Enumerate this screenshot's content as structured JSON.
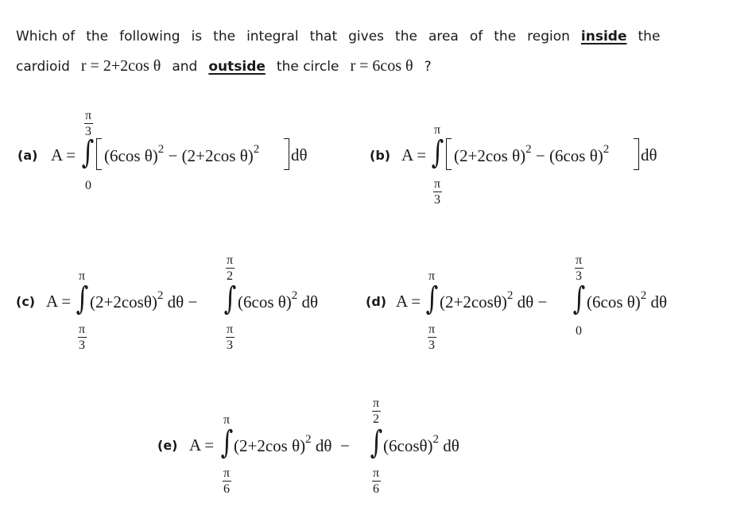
{
  "question": {
    "line1": {
      "words": [
        "Which of",
        "the",
        "following",
        "is",
        "the",
        "integral",
        "that",
        "gives",
        "the",
        "area",
        "of",
        "the",
        "region"
      ],
      "emph1": "inside",
      "tail": "the"
    },
    "line2": {
      "pre": "cardioid",
      "cardioid_eq": "r = 2+2cos θ",
      "and": "and",
      "emph2": "outside",
      "mid": "the circle",
      "circle_eq": "r = 6cos θ",
      "end": "?"
    }
  },
  "options": {
    "a": {
      "label": "(a)",
      "lhs": "A =",
      "upper": {
        "num": "π",
        "den": "3"
      },
      "lower": "0",
      "body": "(6cos θ)",
      "body_exp": "2",
      "minus": " − ",
      "body2": "(2+2cos θ)",
      "body2_exp": "2",
      "d": "dθ"
    },
    "b": {
      "label": "(b)",
      "lhs": "A =",
      "upper": "π",
      "lower": {
        "num": "π",
        "den": "3"
      },
      "body": "(2+2cos θ)",
      "body_exp": "2",
      "minus": " − ",
      "body2": "(6cos θ)",
      "body2_exp": "2",
      "d": "dθ"
    },
    "c": {
      "label": "(c)",
      "lhs": "A =",
      "int1": {
        "upper": "π",
        "lower": {
          "num": "π",
          "den": "3"
        },
        "body": "(2+2cosθ)",
        "exp": "2",
        "d": " dθ"
      },
      "minus": " − ",
      "int2": {
        "upper": {
          "num": "π",
          "den": "2"
        },
        "lower": {
          "num": "π",
          "den": "3"
        },
        "body": "(6cos θ)",
        "exp": "2",
        "d": " dθ"
      }
    },
    "d": {
      "label": "(d)",
      "lhs": "A =",
      "int1": {
        "upper": "π",
        "lower": {
          "num": "π",
          "den": "3"
        },
        "body": "(2+2cosθ)",
        "exp": "2",
        "d": " dθ"
      },
      "minus": " − ",
      "int2": {
        "upper": {
          "num": "π",
          "den": "3"
        },
        "lower": "0",
        "body": "(6cos θ)",
        "exp": "2",
        "d": " dθ"
      }
    },
    "e": {
      "label": "(e)",
      "lhs": "A =",
      "int1": {
        "upper": "π",
        "lower": {
          "num": "π",
          "den": "6"
        },
        "body": "(2+2cos θ)",
        "exp": "2",
        "d": " dθ"
      },
      "minus": " − ",
      "int2": {
        "upper": {
          "num": "π",
          "den": "2"
        },
        "lower": {
          "num": "π",
          "den": "6"
        },
        "body": "(6cosθ)",
        "exp": "2",
        "d": " dθ"
      }
    }
  }
}
